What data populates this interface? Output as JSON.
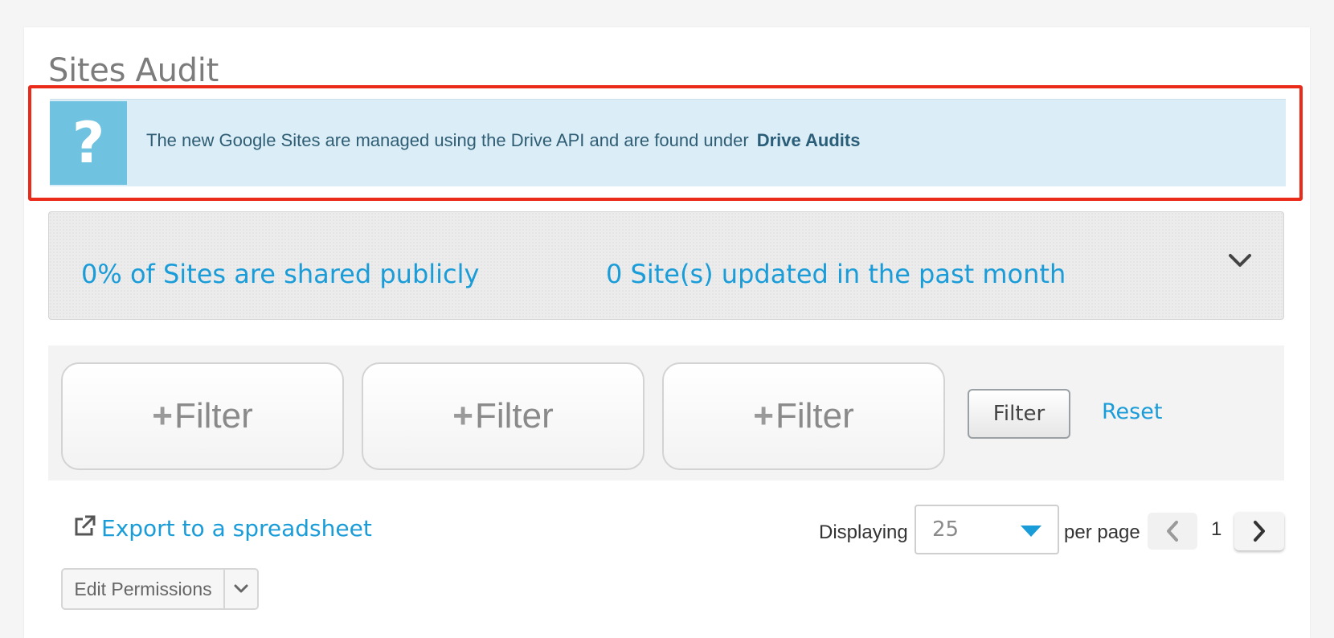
{
  "page": {
    "title": "Sites Audit"
  },
  "info_banner": {
    "icon": "question-mark-icon",
    "icon_glyph": "?",
    "text": "The new Google Sites are managed using the Drive API and are found under",
    "link": "Drive Audits"
  },
  "highlight_color": "#ea2b1a",
  "stats": {
    "public_share": "0% of Sites are shared publicly",
    "updated": "0 Site(s) updated in the past month",
    "toggle_icon": "chevron-down-icon"
  },
  "filters": {
    "slots": [
      {
        "plus": "+",
        "label": "Filter"
      },
      {
        "plus": "+",
        "label": "Filter"
      },
      {
        "plus": "+",
        "label": "Filter"
      }
    ],
    "filter_button": "Filter",
    "reset_link": "Reset"
  },
  "toolbar": {
    "export_icon": "external-link-icon",
    "export_label": "Export to a spreadsheet",
    "displaying_label": "Displaying",
    "per_page_value": "25",
    "per_page_label": "per page",
    "current_page": "1",
    "edit_permissions_label": "Edit Permissions"
  },
  "colors": {
    "accent": "#1a9cd8",
    "banner_bg": "#dbeef8",
    "banner_icon_bg": "#6fc3e0"
  }
}
